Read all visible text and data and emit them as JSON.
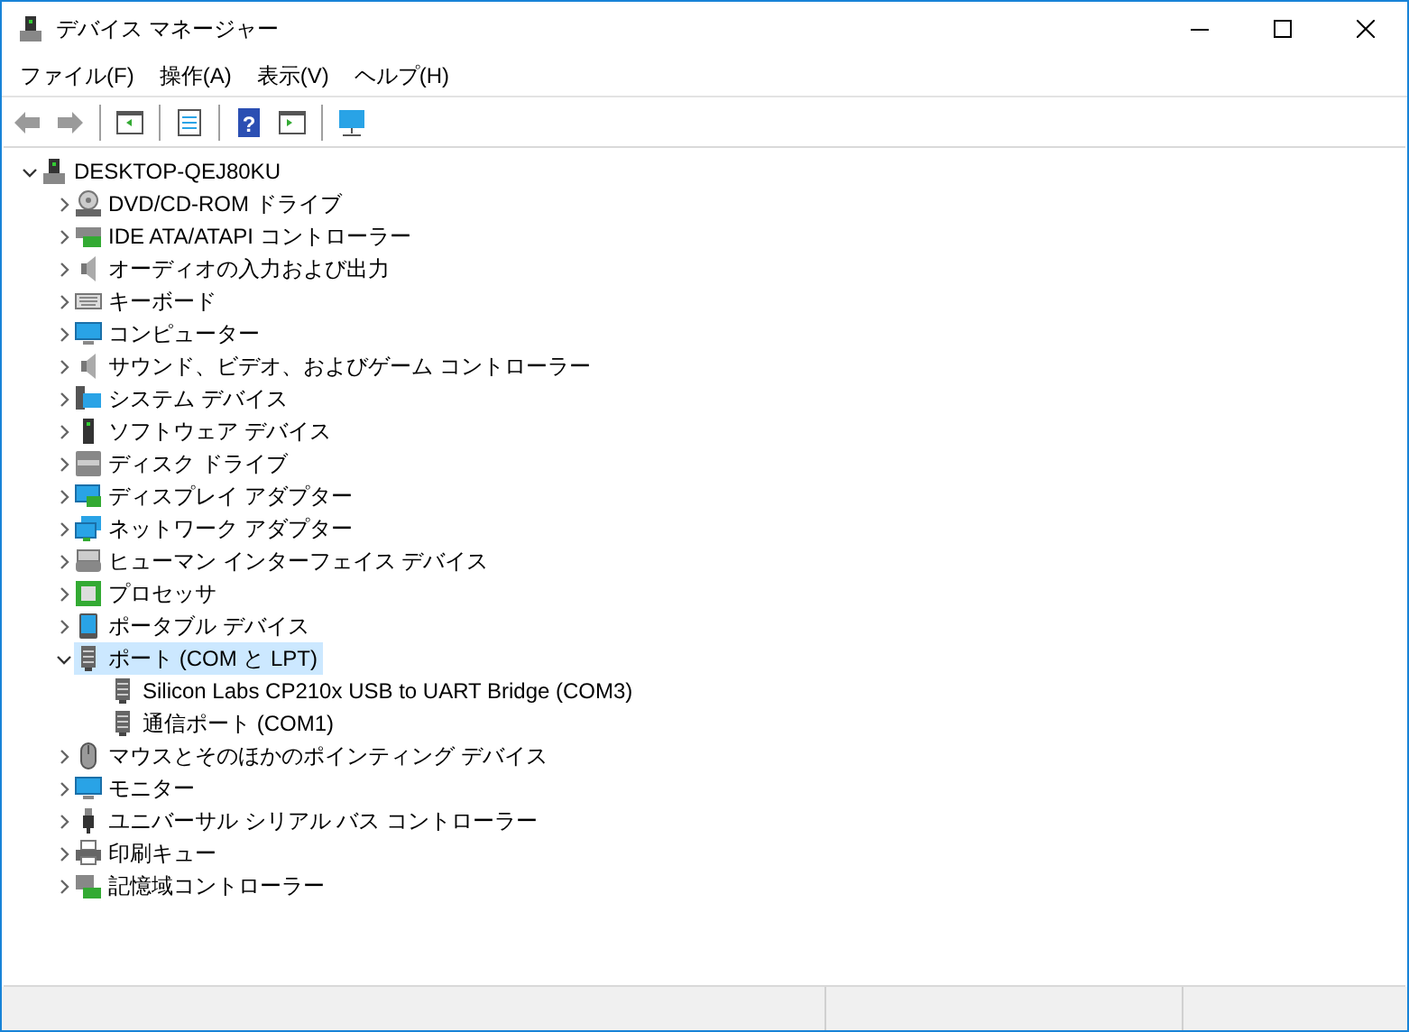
{
  "window": {
    "title": "デバイス マネージャー"
  },
  "menu": [
    "ファイル(F)",
    "操作(A)",
    "表示(V)",
    "ヘルプ(H)"
  ],
  "toolbar": [
    {
      "kind": "back",
      "disabled": true
    },
    {
      "kind": "forward",
      "disabled": true
    },
    {
      "kind": "separator"
    },
    {
      "kind": "pane",
      "disabled": false
    },
    {
      "kind": "separator"
    },
    {
      "kind": "properties",
      "disabled": false
    },
    {
      "kind": "separator"
    },
    {
      "kind": "help",
      "disabled": false,
      "glyph": "?"
    },
    {
      "kind": "run",
      "disabled": false
    },
    {
      "kind": "separator"
    },
    {
      "kind": "scan",
      "disabled": false
    }
  ],
  "tree": {
    "label": "DESKTOP-QEJ80KU",
    "kind": "computer-tower",
    "expanded": true,
    "selected": false,
    "children": [
      {
        "label": "DVD/CD-ROM ドライブ",
        "kind": "disc",
        "expanded": false,
        "selected": false
      },
      {
        "label": "IDE ATA/ATAPI コントローラー",
        "kind": "card",
        "expanded": false,
        "selected": false
      },
      {
        "label": "オーディオの入力および出力",
        "kind": "speaker",
        "expanded": false,
        "selected": false
      },
      {
        "label": "キーボード",
        "kind": "keyboard",
        "expanded": false,
        "selected": false
      },
      {
        "label": "コンピューター",
        "kind": "monitor",
        "expanded": false,
        "selected": false
      },
      {
        "label": "サウンド、ビデオ、およびゲーム コントローラー",
        "kind": "speaker",
        "expanded": false,
        "selected": false
      },
      {
        "label": "システム デバイス",
        "kind": "system",
        "expanded": false,
        "selected": false
      },
      {
        "label": "ソフトウェア デバイス",
        "kind": "tower",
        "expanded": false,
        "selected": false
      },
      {
        "label": "ディスク ドライブ",
        "kind": "drive",
        "expanded": false,
        "selected": false
      },
      {
        "label": "ディスプレイ アダプター",
        "kind": "display",
        "expanded": false,
        "selected": false
      },
      {
        "label": "ネットワーク アダプター",
        "kind": "network",
        "expanded": false,
        "selected": false
      },
      {
        "label": "ヒューマン インターフェイス デバイス",
        "kind": "hid",
        "expanded": false,
        "selected": false
      },
      {
        "label": "プロセッサ",
        "kind": "chip",
        "expanded": false,
        "selected": false
      },
      {
        "label": "ポータブル デバイス",
        "kind": "phone",
        "expanded": false,
        "selected": false
      },
      {
        "label": "ポート (COM と LPT)",
        "kind": "port",
        "expanded": true,
        "selected": true,
        "children": [
          {
            "label": "Silicon Labs CP210x USB to UART Bridge (COM3)",
            "kind": "port",
            "selected": false
          },
          {
            "label": "通信ポート (COM1)",
            "kind": "port",
            "selected": false
          }
        ]
      },
      {
        "label": "マウスとそのほかのポインティング デバイス",
        "kind": "mouse",
        "expanded": false,
        "selected": false
      },
      {
        "label": "モニター",
        "kind": "monitor",
        "expanded": false,
        "selected": false
      },
      {
        "label": "ユニバーサル シリアル バス コントローラー",
        "kind": "usb",
        "expanded": false,
        "selected": false
      },
      {
        "label": "印刷キュー",
        "kind": "printer",
        "expanded": false,
        "selected": false
      },
      {
        "label": "記憶域コントローラー",
        "kind": "storage",
        "expanded": false,
        "selected": false
      }
    ]
  }
}
